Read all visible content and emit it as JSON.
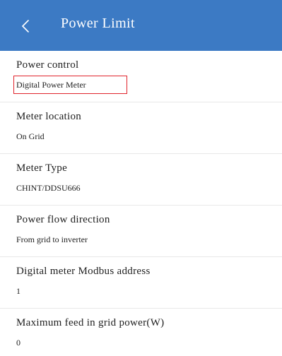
{
  "header": {
    "title": "Power Limit",
    "back_icon": "chevron-left-icon",
    "color": "#3c7ac4"
  },
  "settings": [
    {
      "label": "Power control",
      "value": "Digital Power Meter"
    },
    {
      "label": "Meter location",
      "value": "On Grid"
    },
    {
      "label": "Meter Type",
      "value": "CHINT/DDSU666"
    },
    {
      "label": "Power flow direction",
      "value": "From grid to inverter"
    },
    {
      "label": "Digital meter Modbus address",
      "value": "1"
    },
    {
      "label": "Maximum feed in grid power(W)",
      "value": "0"
    }
  ],
  "highlight_color": "#e0242c"
}
